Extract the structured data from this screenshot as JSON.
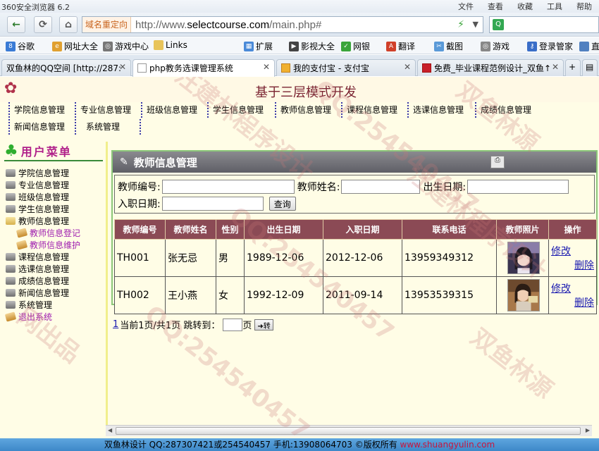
{
  "browser": {
    "title": "360安全浏览器 6.2",
    "menu": [
      "文件",
      "查看",
      "收藏",
      "工具",
      "帮助"
    ],
    "address_tag": "域名重定向",
    "url_prefix": "http://www.",
    "url_host": "selectcourse.com",
    "url_path": "/main.php#",
    "favorites": [
      "谷歌",
      "网址大全",
      "游戏中心",
      "Links",
      "扩展",
      "影视大全",
      "网银",
      "翻译",
      "截图",
      "游戏",
      "登录管家",
      "直"
    ],
    "tabs": [
      {
        "label": "双鱼林的QQ空间 [http://287:"
      },
      {
        "label": "php教务选课管理系统"
      },
      {
        "label": "我的支付宝 - 支付宝"
      },
      {
        "label": "免费_毕业课程范例设计_双鱼↑"
      }
    ]
  },
  "header": {
    "subtitle": "基于三层模式开发"
  },
  "mainmenu": [
    "学院信息管理",
    "专业信息管理",
    "班级信息管理",
    "学生信息管理",
    "教师信息管理",
    "课程信息管理",
    "选课信息管理",
    "成绩信息管理",
    "新闻信息管理",
    "系统管理"
  ],
  "sidebar": {
    "title": "用户菜单",
    "items": [
      {
        "label": "学院信息管理",
        "type": "normal"
      },
      {
        "label": "专业信息管理",
        "type": "normal"
      },
      {
        "label": "班级信息管理",
        "type": "normal"
      },
      {
        "label": "学生信息管理",
        "type": "normal"
      },
      {
        "label": "教师信息管理",
        "type": "open"
      },
      {
        "label": "教师信息登记",
        "type": "sub"
      },
      {
        "label": "教师信息维护",
        "type": "sub"
      },
      {
        "label": "课程信息管理",
        "type": "normal"
      },
      {
        "label": "选课信息管理",
        "type": "normal"
      },
      {
        "label": "成绩信息管理",
        "type": "normal"
      },
      {
        "label": "新闻信息管理",
        "type": "normal"
      },
      {
        "label": "系统管理",
        "type": "normal"
      },
      {
        "label": "退出系统",
        "type": "logout"
      }
    ]
  },
  "panel": {
    "title": "教师信息管理",
    "search": {
      "teacher_no_label": "教师编号:",
      "teacher_name_label": "教师姓名:",
      "birth_label": "出生日期:",
      "hire_label": "入职日期:",
      "query_button": "查询"
    },
    "columns": [
      "教师编号",
      "教师姓名",
      "性别",
      "出生日期",
      "入职日期",
      "联系电话",
      "教师照片",
      "操作"
    ],
    "rows": [
      {
        "no": "TH001",
        "name": "张无忌",
        "gender": "男",
        "birth": "1989-12-06",
        "hire": "2012-12-06",
        "phone": "13959349312",
        "edit": "修改",
        "delete": "删除"
      },
      {
        "no": "TH002",
        "name": "王小燕",
        "gender": "女",
        "birth": "1992-12-09",
        "hire": "2011-09-14",
        "phone": "13953539315",
        "edit": "修改",
        "delete": "删除"
      }
    ]
  },
  "pager": {
    "page_link": "1",
    "info": "当前1页/共1页 跳转到：",
    "page_unit": "页",
    "go": "转"
  },
  "footer": {
    "text": "双鱼林设计 QQ:287307421或254540457 手机:13908064703 ©版权所有 ",
    "site": "www.shuangyulin.com"
  },
  "watermarks": [
    "汪建林程序设计",
    "QQ:254540457",
    "双鱼林源",
    "汪建林程序设计",
    "QQ:254540457",
    "网出品",
    "双鱼林源",
    "QQ:254540457"
  ]
}
